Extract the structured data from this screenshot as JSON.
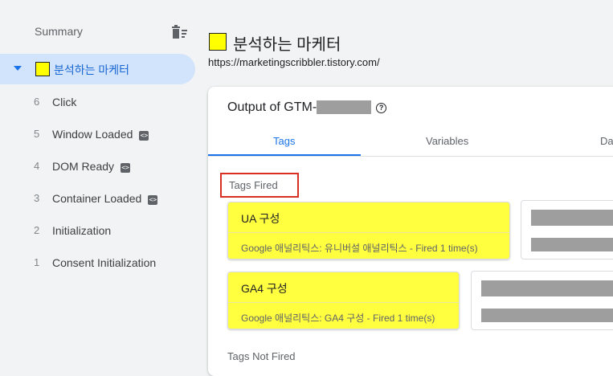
{
  "sidebar": {
    "summary_label": "Summary",
    "selected_event": {
      "label": "분석하는 마케터",
      "color": "#ffff00"
    },
    "events": [
      {
        "num": "6",
        "label": "Click",
        "code": false
      },
      {
        "num": "5",
        "label": "Window Loaded",
        "code": true
      },
      {
        "num": "4",
        "label": "DOM Ready",
        "code": true
      },
      {
        "num": "3",
        "label": "Container Loaded",
        "code": true
      },
      {
        "num": "2",
        "label": "Initialization",
        "code": false
      },
      {
        "num": "1",
        "label": "Consent Initialization",
        "code": false
      }
    ]
  },
  "main": {
    "title": "분석하는 마케터",
    "url": "https://marketingscribbler.tistory.com/",
    "output_title_prefix": "Output of GTM-",
    "tabs": [
      {
        "label": "Tags"
      },
      {
        "label": "Variables"
      },
      {
        "label": "Da"
      }
    ],
    "active_tab": "Tags",
    "tags_fired_label": "Tags Fired",
    "tags_fired": [
      {
        "name": "UA 구성",
        "subtitle": "Google 애널리틱스: 유니버설 애널리틱스 - Fired 1 time(s)"
      },
      {
        "name": "GA4 구성",
        "subtitle": "Google 애널리틱스: GA4 구성 - Fired 1 time(s)"
      }
    ],
    "tags_not_fired_label": "Tags Not Fired"
  },
  "colors": {
    "accent": "#1a73e8",
    "highlight": "#ffff40",
    "callout": "#d93025"
  }
}
